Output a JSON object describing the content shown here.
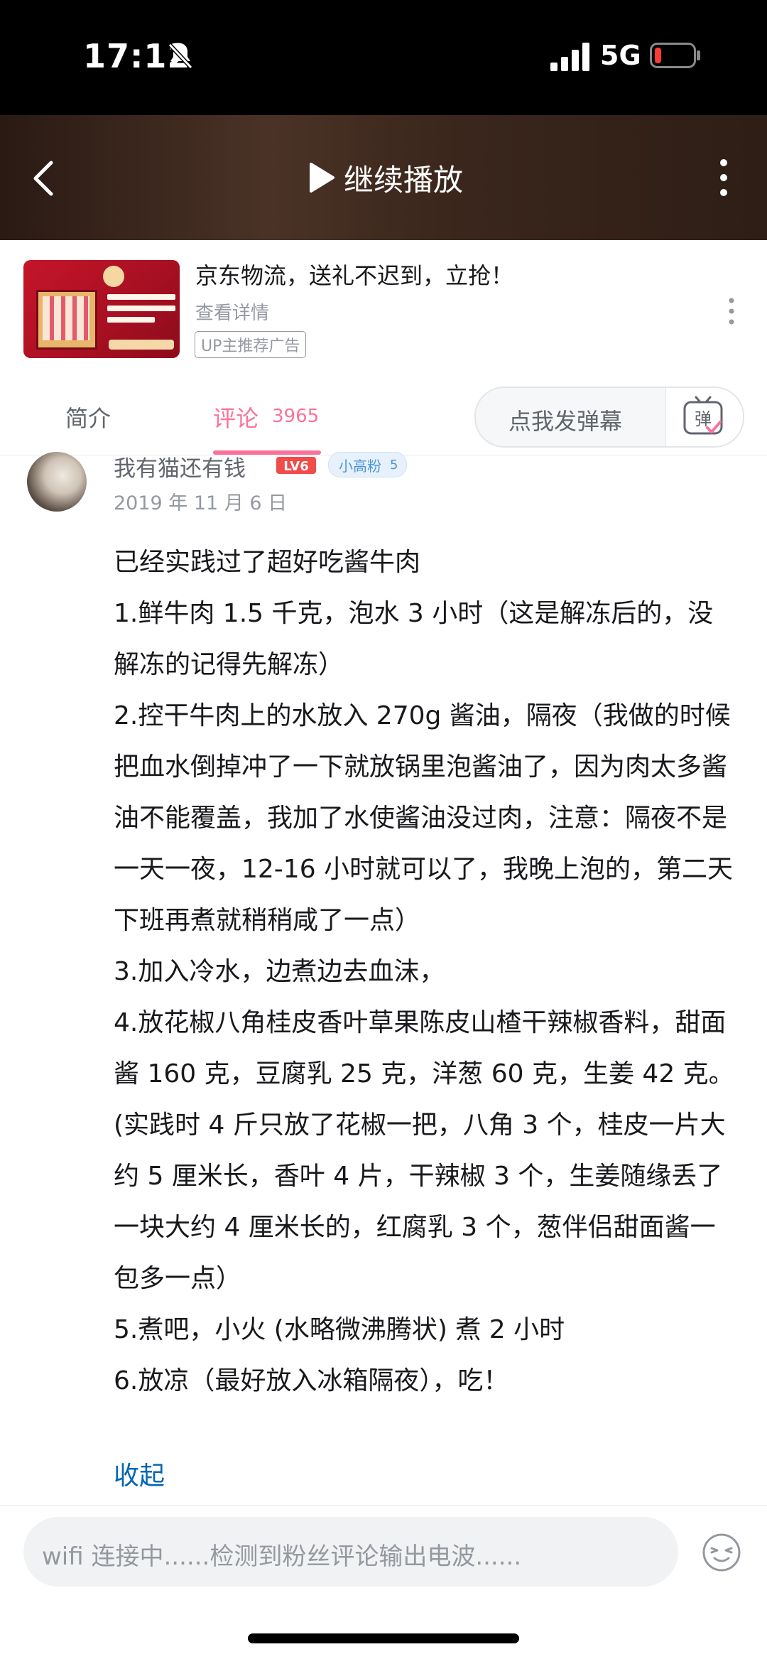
{
  "status_bar": {
    "time": "17:12",
    "network": "5G"
  },
  "video_header": {
    "continue_label": "继续播放"
  },
  "ad": {
    "title": "京东物流，送礼不迟到，立抢！",
    "subtitle": "查看详情",
    "tag": "UP主推荐广告"
  },
  "tabs": [
    {
      "label": "简介"
    },
    {
      "label": "评论",
      "count": "3965"
    }
  ],
  "danmaku": {
    "placeholder": "点我发弹幕",
    "icon_label": "弹"
  },
  "comment": {
    "username": "我有猫还有钱",
    "level": "LV6",
    "fan_badge": {
      "label": "小高粉",
      "level": "5"
    },
    "date": "2019 年 11 月 6 日",
    "text": "已经实践过了超好吃酱牛肉\n1.鲜牛肉 1.5 千克，泡水 3 小时（这是解冻后的，没解冻的记得先解冻）\n2.控干牛肉上的水放入 270g 酱油，隔夜（我做的时候把血水倒掉冲了一下就放锅里泡酱油了，因为肉太多酱油不能覆盖，我加了水使酱油没过肉，注意：隔夜不是一天一夜，12-16 小时就可以了，我晚上泡的，第二天下班再煮就稍稍咸了一点）\n3.加入冷水，边煮边去血沫，\n4.放花椒八角桂皮香叶草果陈皮山楂干辣椒香料，甜面酱 160 克，豆腐乳 25 克，洋葱 60 克，生姜 42 克。(实践时 4 斤只放了花椒一把，八角 3 个，桂皮一片大约 5 厘米长，香叶 4 片，干辣椒 3 个，生姜随缘丢了一块大约 4 厘米长的，红腐乳 3 个，葱伴侣甜面酱一包多一点）\n5.煮吧，小火 (水略微沸腾状) 煮 2 小时\n6.放凉（最好放入冰箱隔夜），吃！",
    "collapse_label": "收起"
  },
  "comment_input": {
    "placeholder": "wifi 连接中......检测到粉丝评论输出电波......"
  },
  "colors": {
    "accent_pink": "#fb7299",
    "link_blue": "#0066b3",
    "level_red": "#f04c49",
    "fan_blue": "#4c93d6"
  },
  "icons": [
    "bell-slash-icon",
    "signal-icon",
    "battery-icon",
    "back-icon",
    "play-icon",
    "more-icon",
    "danmaku-icon",
    "emoji-icon"
  ]
}
